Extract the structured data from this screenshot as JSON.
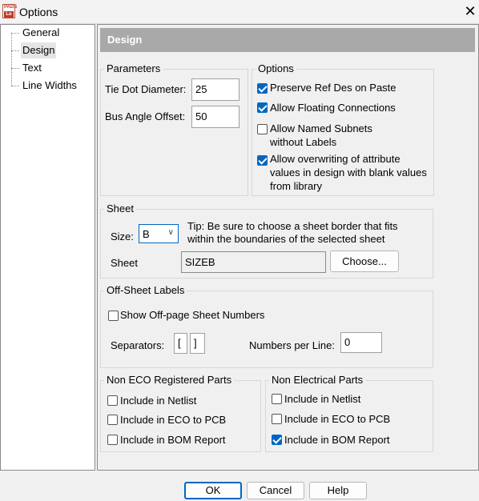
{
  "window": {
    "title": "Options",
    "app_icon_top": "PADS",
    "app_icon_bottom": "Lo"
  },
  "tree": {
    "items": [
      "General",
      "Design",
      "Text",
      "Line Widths"
    ],
    "selected": "Design"
  },
  "header": {
    "title": "Design"
  },
  "parameters": {
    "legend": "Parameters",
    "tie_dot_label": "Tie Dot Diameter:",
    "tie_dot_value": "25",
    "bus_angle_label": "Bus Angle Offset:",
    "bus_angle_value": "50"
  },
  "options": {
    "legend": "Options",
    "preserve": {
      "label": "Preserve Ref Des on Paste",
      "checked": true
    },
    "floating": {
      "label": "Allow Floating Connections",
      "checked": true
    },
    "named_subnets": {
      "line1": "Allow Named Subnets",
      "line2": "without Labels",
      "checked": false
    },
    "overwrite": {
      "line1": "Allow overwriting of attribute",
      "line2": "values in design with blank values",
      "line3": "from library",
      "checked": true
    }
  },
  "sheet": {
    "legend": "Sheet",
    "size_label": "Size:",
    "size_value": "B",
    "tip_line1": "Tip: Be sure to choose a sheet border that fits",
    "tip_line2": "within the boundaries of the selected sheet",
    "sheet_label": "Sheet",
    "sheet_value": "SIZEB",
    "choose_button": "Choose..."
  },
  "offsheet": {
    "legend": "Off-Sheet Labels",
    "show_numbers": {
      "label": "Show Off-page Sheet Numbers",
      "checked": false
    },
    "separators_label": "Separators:",
    "sep_open": "[",
    "sep_close": "]",
    "numbers_per_line_label": "Numbers per Line:",
    "numbers_per_line_value": "0"
  },
  "non_eco": {
    "legend": "Non ECO Registered Parts",
    "netlist": {
      "label": "Include in Netlist",
      "checked": false
    },
    "eco_pcb": {
      "label": "Include in ECO to PCB",
      "checked": false
    },
    "bom": {
      "label": "Include in BOM Report",
      "checked": false
    }
  },
  "non_electrical": {
    "legend": "Non Electrical Parts",
    "netlist": {
      "label": "Include in Netlist",
      "checked": false
    },
    "eco_pcb": {
      "label": "Include in ECO to PCB",
      "checked": false
    },
    "bom": {
      "label": "Include in BOM Report",
      "checked": true
    }
  },
  "buttons": {
    "ok": "OK",
    "cancel": "Cancel",
    "help": "Help"
  },
  "icons": {
    "close": "close-icon",
    "app": "pads-logo-icon",
    "dropdown": "chevron-down-icon"
  },
  "colors": {
    "accent": "#0067c0",
    "header_bg": "#a9a9a9"
  }
}
